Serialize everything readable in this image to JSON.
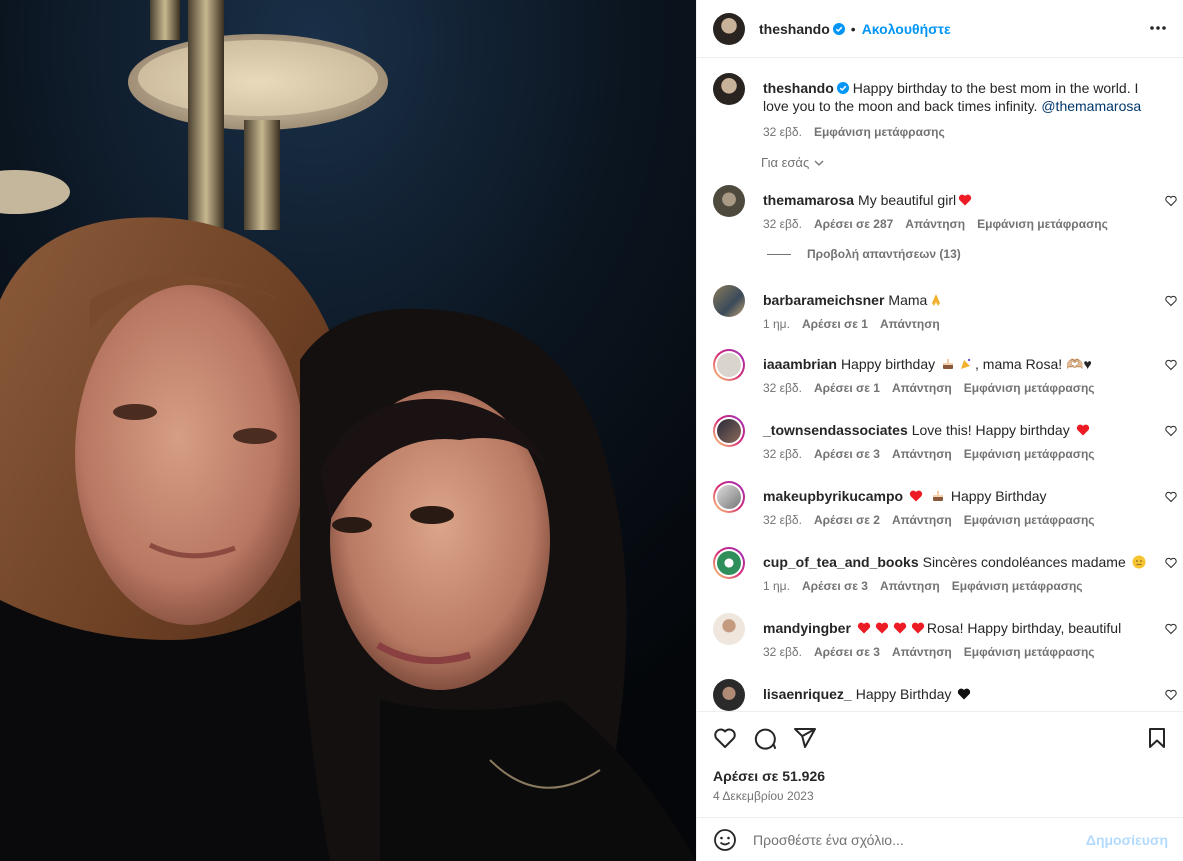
{
  "post": {
    "author": "theshando",
    "follow_label": "Ακολουθήστε",
    "dot": "•",
    "caption_text": "Happy birthday to the best mom in the world. I love you to the moon and back times infinity. ",
    "caption_mention": "@themamarosa",
    "caption_age": "32 εβδ.",
    "see_translation": "Εμφάνιση μετάφρασης",
    "for_you_label": "Για εσάς",
    "likes": "Αρέσει σε 51.926",
    "date": "4 Δεκεμβρίου 2023"
  },
  "replies_toggle": "Προβολή απαντήσεων (13)",
  "comments": [
    {
      "user": "themamarosa",
      "text": "My beautiful girl",
      "emojis": [
        "heart"
      ],
      "age": "32 εβδ.",
      "likes": "Αρέσει σε 287",
      "reply": "Απάντηση",
      "translate": "Εμφάνιση μετάφρασης",
      "avatar_color": "#6b6a5c"
    },
    {
      "user": "barbarameichsner",
      "text": "Mama",
      "emojis": [
        "pray"
      ],
      "age": "1 ημ.",
      "likes": "Αρέσει σε 1",
      "reply": "Απάντηση",
      "translate": "",
      "avatar_color": "#7b6b4f"
    },
    {
      "user": "iaaambrian",
      "text": "Happy birthday",
      "text_after": ", mama Rosa! 🫶🏼♥",
      "emojis": [
        "cake",
        "party"
      ],
      "age": "32 εβδ.",
      "likes": "Αρέσει σε 1",
      "reply": "Απάντηση",
      "translate": "Εμφάνιση μετάφρασης",
      "avatar_color": "#d9d4cc"
    },
    {
      "user": "_townsendassociates",
      "text": "Love this! Happy birthday",
      "emojis": [
        "heart"
      ],
      "age": "32 εβδ.",
      "likes": "Αρέσει σε 3",
      "reply": "Απάντηση",
      "translate": "Εμφάνιση μετάφρασης",
      "avatar_color": "#4a4a5a"
    },
    {
      "user": "makeupbyrikucampo",
      "text": "Happy Birthday",
      "emojis_before": [
        "heart",
        "cake"
      ],
      "emojis": [],
      "age": "32 εβδ.",
      "likes": "Αρέσει σε 2",
      "reply": "Απάντηση",
      "translate": "Εμφάνιση μετάφρασης",
      "avatar_color": "#b8b8b8"
    },
    {
      "user": "cup_of_tea_and_books",
      "text": "Sincères condoléances madame",
      "emojis": [
        "sad"
      ],
      "age": "1 ημ.",
      "likes": "Αρέσει σε 3",
      "reply": "Απάντηση",
      "translate": "Εμφάνιση μετάφρασης",
      "avatar_color": "#2f8f5b"
    },
    {
      "user": "mandyingber",
      "text": "Rosa! Happy birthday, beautiful",
      "emojis_before": [
        "heart",
        "heart",
        "heart",
        "heart"
      ],
      "emojis": [],
      "age": "32 εβδ.",
      "likes": "Αρέσει σε 3",
      "reply": "Απάντηση",
      "translate": "Εμφάνιση μετάφρασης",
      "avatar_color": "#e8dcd4"
    },
    {
      "user": "lisaenriquez_",
      "text": "Happy Birthday",
      "emojis": [
        "blackheart"
      ],
      "age": "",
      "likes": "",
      "reply": "",
      "translate": "",
      "avatar_color": "#3a3a3a"
    }
  ],
  "composer": {
    "placeholder": "Προσθέστε ένα σχόλιο...",
    "post_label": "Δημοσίευση"
  },
  "colors": {
    "accent": "#0095f6",
    "heart": "#ed1c24",
    "muted": "#737373",
    "mention": "#00376b"
  }
}
